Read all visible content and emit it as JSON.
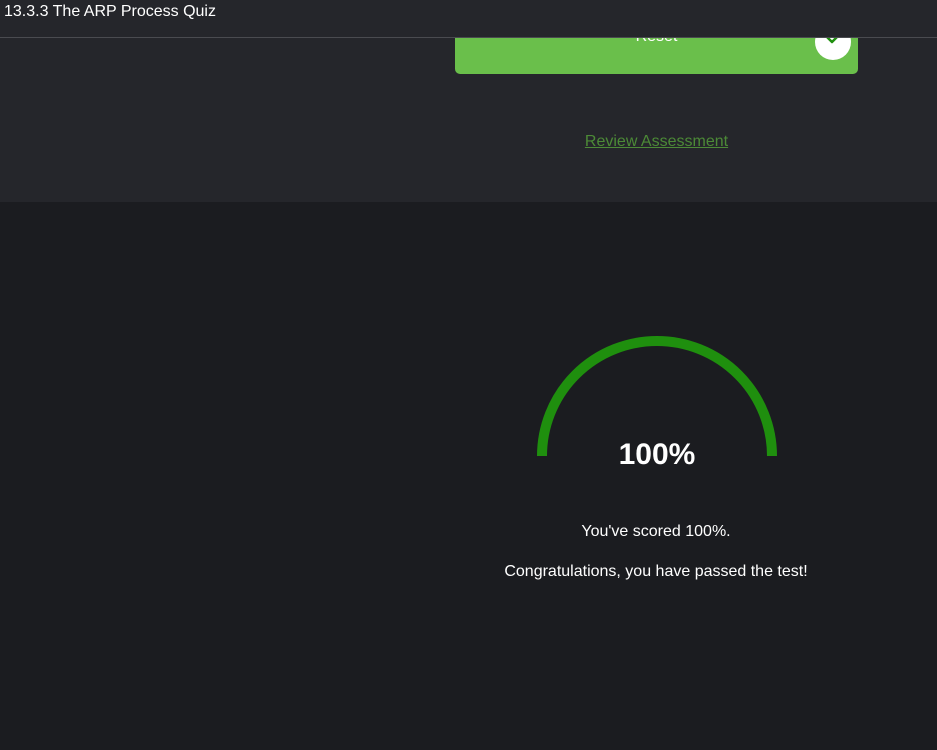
{
  "window": {
    "title": "13.3.3 The ARP Process Quiz"
  },
  "actions": {
    "reset_label": "Reset",
    "review_label": "Review Assessment"
  },
  "result": {
    "percent": 100,
    "score_display": "100%",
    "score_message": "You've scored 100%.",
    "congrats_message": "Congratulations, you have passed the test!"
  },
  "colors": {
    "accent_green": "#6abf4b",
    "gauge_green": "#1f8f0e",
    "link_green": "#4c8a37"
  },
  "icons": {
    "badge": "checkmark-icon"
  }
}
